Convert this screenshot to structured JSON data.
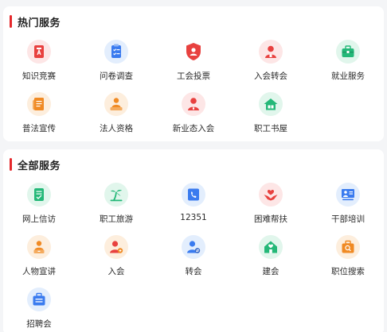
{
  "hot_services": {
    "title": "热门服务",
    "items": [
      {
        "label": "知识竞赛",
        "icon": "quiz-book-icon",
        "color": "#e8413f"
      },
      {
        "label": "问卷调查",
        "icon": "clipboard-checklist-icon",
        "color": "#3a7bef"
      },
      {
        "label": "工会投票",
        "icon": "shield-vote-icon",
        "color": "#e8413f"
      },
      {
        "label": "入会转会",
        "icon": "member-transfer-icon",
        "color": "#e8413f"
      },
      {
        "label": "就业服务",
        "icon": "briefcase-icon",
        "color": "#24b878"
      },
      {
        "label": "普法宣传",
        "icon": "law-scroll-icon",
        "color": "#f08a24"
      },
      {
        "label": "法人资格",
        "icon": "legal-person-icon",
        "color": "#f08a24"
      },
      {
        "label": "新业态入会",
        "icon": "new-member-icon",
        "color": "#e8413f"
      },
      {
        "label": "职工书屋",
        "icon": "library-house-icon",
        "color": "#24b878"
      }
    ]
  },
  "all_services": {
    "title": "全部服务",
    "items": [
      {
        "label": "网上信访",
        "icon": "online-petition-icon",
        "color": "#24b878"
      },
      {
        "label": "职工旅游",
        "icon": "palm-tree-icon",
        "color": "#24b878"
      },
      {
        "label": "12351",
        "icon": "phone-hotline-icon",
        "color": "#3a7bef"
      },
      {
        "label": "困难帮扶",
        "icon": "helping-hands-icon",
        "color": "#e8413f"
      },
      {
        "label": "干部培训",
        "icon": "training-board-icon",
        "color": "#3a7bef"
      },
      {
        "label": "人物宣讲",
        "icon": "speaker-person-icon",
        "color": "#f08a24"
      },
      {
        "label": "入会",
        "icon": "join-union-icon",
        "color": "#e8413f"
      },
      {
        "label": "转会",
        "icon": "transfer-person-icon",
        "color": "#3a7bef"
      },
      {
        "label": "建会",
        "icon": "build-union-icon",
        "color": "#24b878"
      },
      {
        "label": "职位搜索",
        "icon": "job-search-icon",
        "color": "#f08a24"
      },
      {
        "label": "招聘会",
        "icon": "recruitment-fair-icon",
        "color": "#3a7bef"
      }
    ]
  },
  "theme": {
    "accent": "#e5282b",
    "background": "#f4f5f7",
    "card": "#ffffff"
  }
}
